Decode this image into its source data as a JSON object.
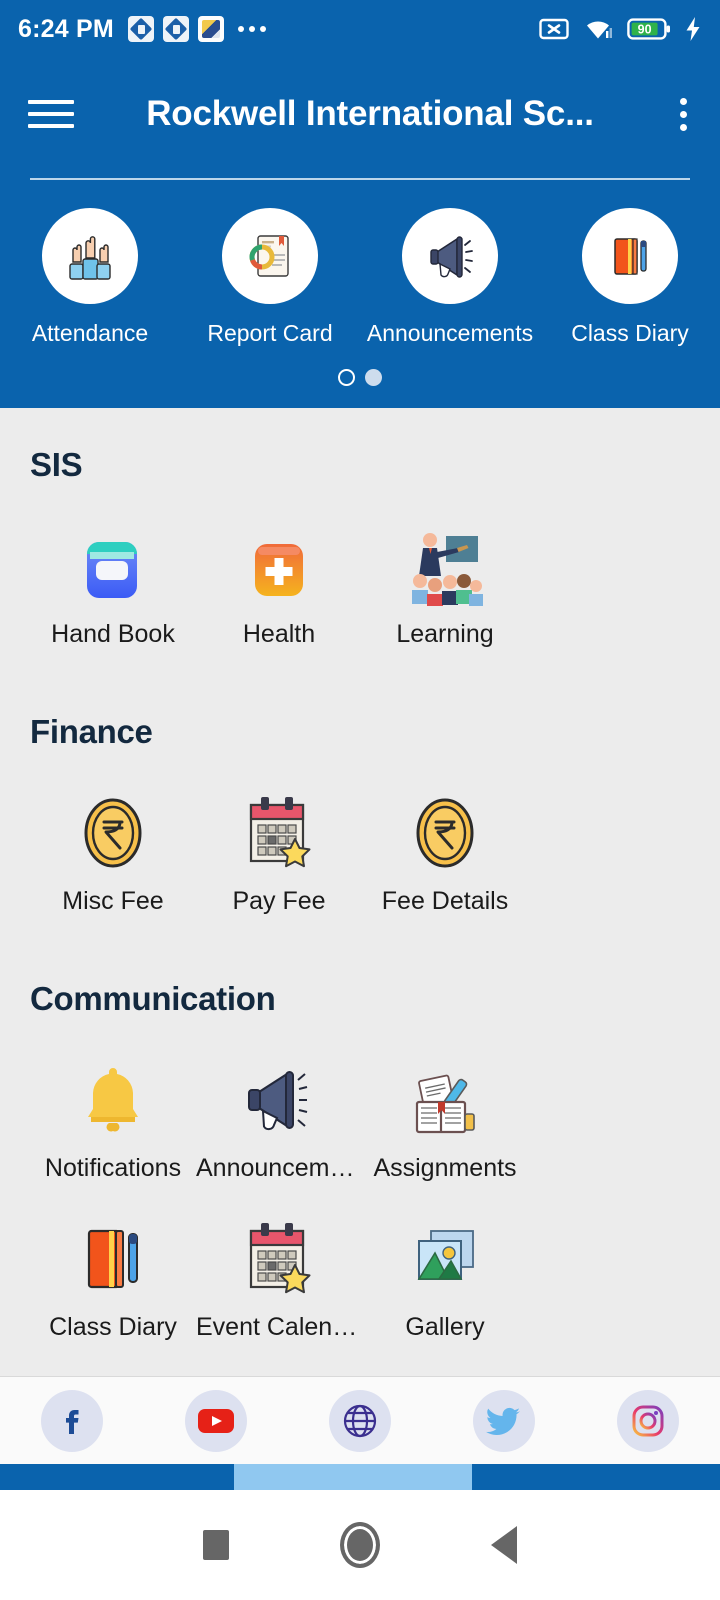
{
  "status_bar": {
    "time": "6:24 PM",
    "left_icons": [
      "app-notification-icon",
      "app-notification-icon",
      "app-notification-icon",
      "more-notifications-icon"
    ],
    "right_icons": [
      "screencast-off-icon",
      "wifi-icon",
      "battery-icon",
      "charging-bolt-icon"
    ],
    "battery_level": "90"
  },
  "app_bar": {
    "menu_icon": "hamburger-menu-icon",
    "title": "Rockwell International Sc...",
    "overflow_icon": "overflow-menu-icon"
  },
  "carousel": {
    "items": [
      {
        "label": "Attendance",
        "icon": "raised-hands-icon"
      },
      {
        "label": "Report Card",
        "icon": "report-chart-icon"
      },
      {
        "label": "Announcements",
        "icon": "megaphone-icon"
      },
      {
        "label": "Class Diary",
        "icon": "diary-book-icon"
      }
    ],
    "dots": [
      {
        "state": "hollow"
      },
      {
        "state": "filled"
      }
    ]
  },
  "sections": [
    {
      "title": "SIS",
      "items": [
        {
          "label": "Hand Book",
          "icon": "handbook-icon"
        },
        {
          "label": "Health",
          "icon": "health-plus-icon"
        },
        {
          "label": "Learning",
          "icon": "classroom-learning-icon"
        }
      ]
    },
    {
      "title": "Finance",
      "items": [
        {
          "label": "Misc Fee",
          "icon": "rupee-coin-icon"
        },
        {
          "label": "Pay Fee",
          "icon": "calendar-star-icon"
        },
        {
          "label": "Fee Details",
          "icon": "rupee-coin-icon"
        }
      ]
    },
    {
      "title": "Communication",
      "items": [
        {
          "label": "Notifications",
          "icon": "bell-icon"
        },
        {
          "label": "Announceme...",
          "icon": "megaphone-icon"
        },
        {
          "label": "Assignments",
          "icon": "assignments-icon"
        },
        {
          "label": "Class Diary",
          "icon": "diary-book-icon"
        },
        {
          "label": "Event Calendar",
          "icon": "calendar-star-icon"
        },
        {
          "label": "Gallery",
          "icon": "gallery-photos-icon"
        }
      ]
    }
  ],
  "social_bar": {
    "items": [
      {
        "name": "facebook",
        "icon": "facebook-icon"
      },
      {
        "name": "youtube",
        "icon": "youtube-icon"
      },
      {
        "name": "website",
        "icon": "globe-icon"
      },
      {
        "name": "twitter",
        "icon": "twitter-icon"
      },
      {
        "name": "instagram",
        "icon": "instagram-icon"
      }
    ]
  },
  "android_nav": {
    "recent_label": "recent-apps-button",
    "home_label": "home-button",
    "back_label": "back-button"
  },
  "colors": {
    "brand_blue": "#0a63ad",
    "page_bg": "#ececec",
    "heading_navy": "#13293f",
    "indicator_light": "#90c8f0",
    "indicator_dark": "#0a63ad"
  }
}
